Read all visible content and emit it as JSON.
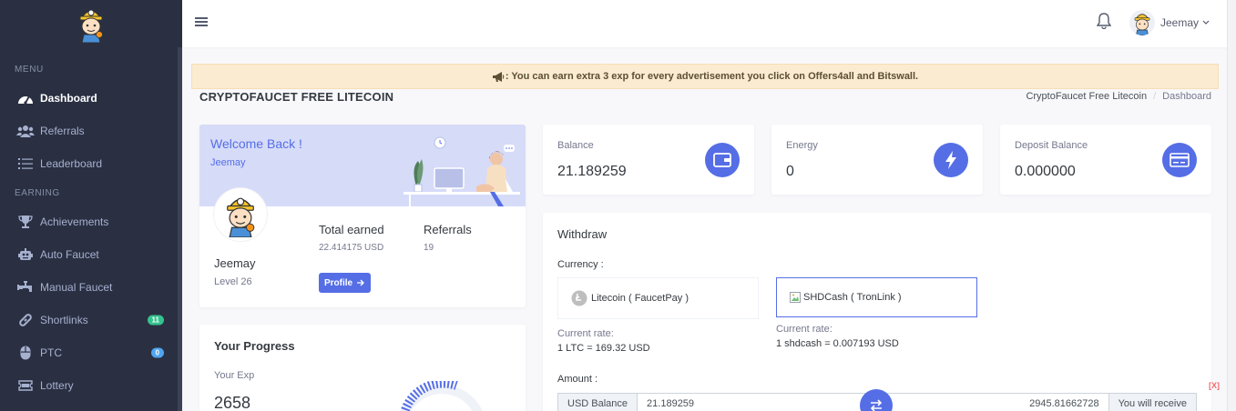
{
  "sidebar": {
    "menu_title": "MENU",
    "earning_title": "EARNING",
    "items": [
      {
        "label": "Dashboard",
        "icon": "dashboard-icon"
      },
      {
        "label": "Referrals",
        "icon": "users-icon"
      },
      {
        "label": "Leaderboard",
        "icon": "list-icon"
      },
      {
        "label": "Achievements",
        "icon": "trophy-icon"
      },
      {
        "label": "Auto Faucet",
        "icon": "robot-icon"
      },
      {
        "label": "Manual Faucet",
        "icon": "faucet-icon"
      },
      {
        "label": "Shortlinks",
        "icon": "link-icon",
        "badge": "11",
        "badge_color": "#34c38f"
      },
      {
        "label": "PTC",
        "icon": "mouse-icon",
        "badge": "0",
        "badge_color": "#50a5f1"
      },
      {
        "label": "Lottery",
        "icon": "ticket-icon"
      }
    ]
  },
  "topbar": {
    "user_name": "Jeemay"
  },
  "alert": {
    "text": ": You can earn extra 3 exp for every advertisement you click on Offers4all and Bitswall."
  },
  "page": {
    "title": "CRYPTOFAUCET FREE LITECOIN",
    "breadcrumb": [
      "CryptoFaucet Free Litecoin",
      "Dashboard"
    ]
  },
  "welcome": {
    "title": "Welcome Back !",
    "subtitle": "Jeemay",
    "name": "Jeemay",
    "level": "Level 26",
    "total_earned_label": "Total earned",
    "total_earned_value": "22.414175 USD",
    "referrals_label": "Referrals",
    "referrals_value": "19",
    "profile_button": "Profile"
  },
  "progress": {
    "title": "Your Progress",
    "exp_label": "Your Exp",
    "exp_value": "2658"
  },
  "stats": [
    {
      "label": "Balance",
      "value": "21.189259",
      "icon": "wallet-icon"
    },
    {
      "label": "Energy",
      "value": "0",
      "icon": "bolt-icon"
    },
    {
      "label": "Deposit Balance",
      "value": "0.000000",
      "icon": "card-icon"
    }
  ],
  "withdraw": {
    "title": "Withdraw",
    "currency_label": "Currency :",
    "options": [
      {
        "label": "Litecoin ( FaucetPay )",
        "rate_label": "Current rate:",
        "rate": "1 LTC = 169.32 USD"
      },
      {
        "label": "SHDCash ( TronLink )",
        "rate_label": "Current rate:",
        "rate": "1 shdcash = 0.007193 USD"
      }
    ],
    "amount_label": "Amount :",
    "usd_balance_label": "USD Balance",
    "amount_value": "21.189259",
    "receive_value": "2945.81662728",
    "receive_label": "You will receive"
  },
  "close_label": "[X]",
  "colors": {
    "primary": "#556ee6",
    "sidebar": "#2a3042",
    "success": "#34c38f",
    "info": "#50a5f1"
  }
}
